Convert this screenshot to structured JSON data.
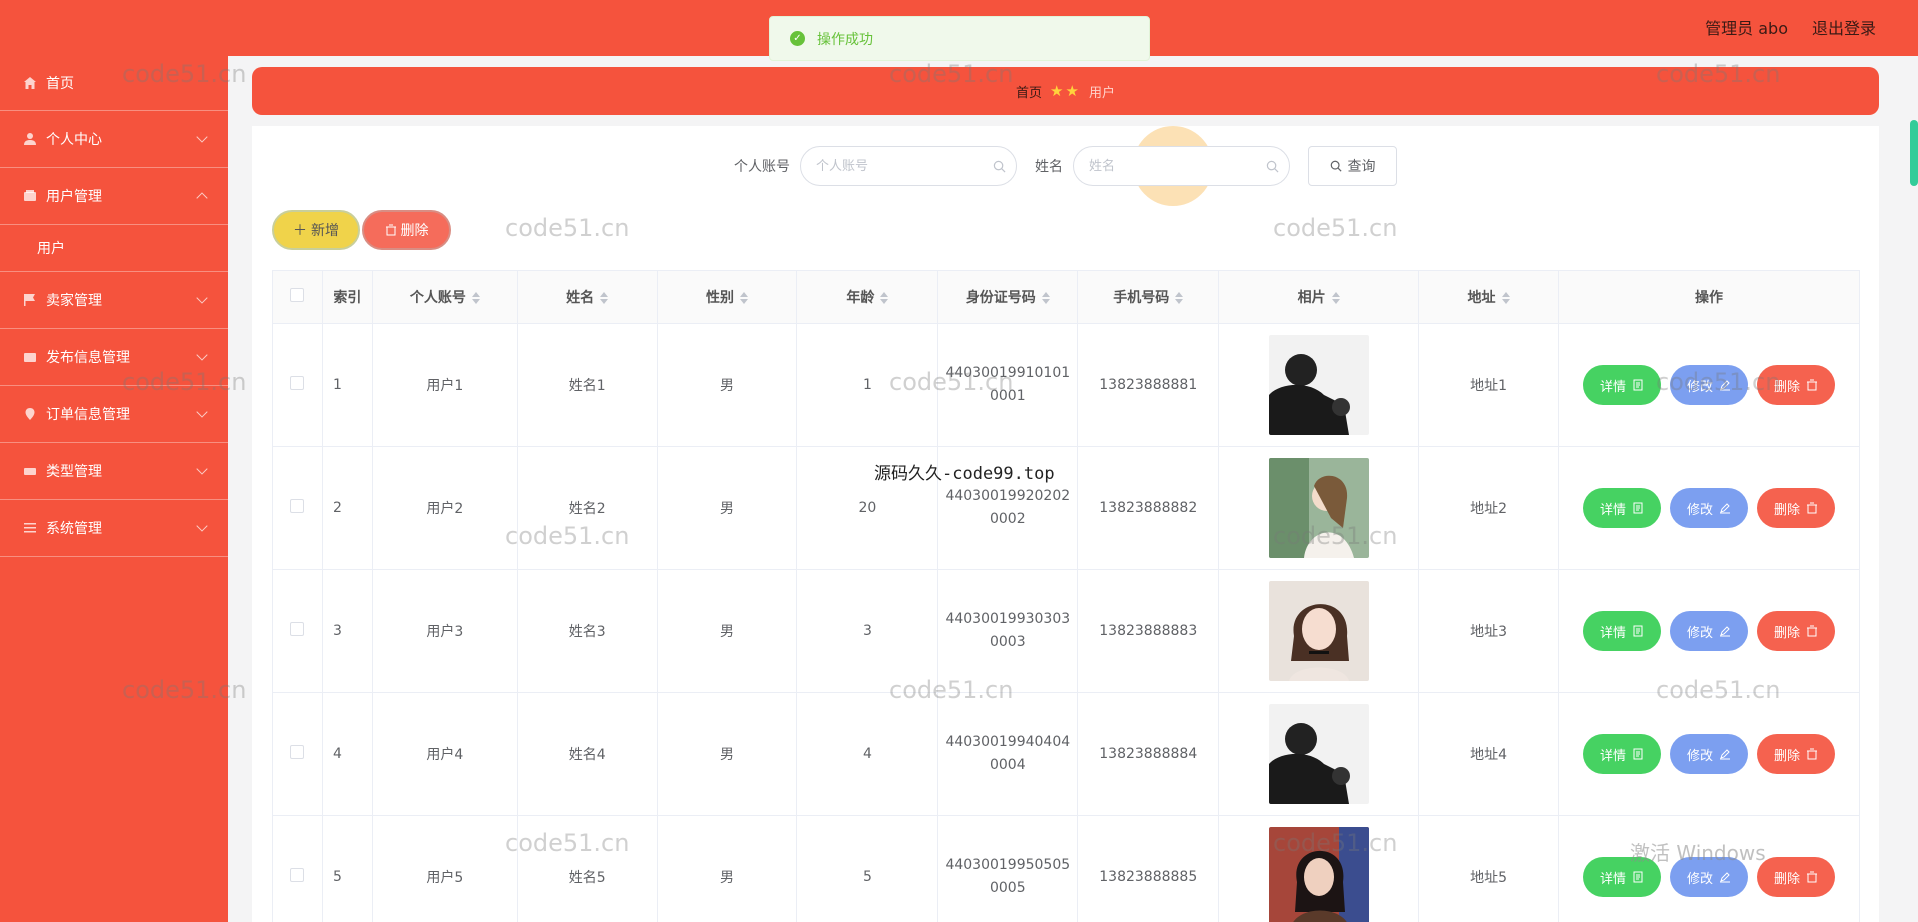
{
  "topbar": {
    "admin_label": "管理员 abo",
    "logout_label": "退出登录"
  },
  "toast": {
    "message": "操作成功"
  },
  "sidebar": {
    "items": [
      {
        "label": "首页",
        "icon": "home-icon"
      },
      {
        "label": "个人中心",
        "icon": "user-icon"
      },
      {
        "label": "用户管理",
        "icon": "folder-icon",
        "sub": "用户"
      },
      {
        "label": "卖家管理",
        "icon": "flag-icon"
      },
      {
        "label": "发布信息管理",
        "icon": "card-icon"
      },
      {
        "label": "订单信息管理",
        "icon": "location-icon"
      },
      {
        "label": "类型管理",
        "icon": "ticket-icon"
      },
      {
        "label": "系统管理",
        "icon": "settings-icon"
      }
    ]
  },
  "breadcrumb": {
    "home": "首页",
    "current": "用户"
  },
  "search": {
    "account_label": "个人账号",
    "account_placeholder": "个人账号",
    "name_label": "姓名",
    "name_placeholder": "姓名",
    "query_label": "查询"
  },
  "actions": {
    "add_label": "新增",
    "delete_label": "删除"
  },
  "table": {
    "headers": [
      "索引",
      "个人账号",
      "姓名",
      "性别",
      "年龄",
      "身份证号码",
      "手机号码",
      "相片",
      "地址",
      "操作"
    ],
    "rows": [
      {
        "index": "1",
        "account": "用户1",
        "name": "姓名1",
        "gender": "男",
        "age": "1",
        "id_a": "44030019910101",
        "id_b": "0001",
        "phone": "13823888881",
        "address": "地址1"
      },
      {
        "index": "2",
        "account": "用户2",
        "name": "姓名2",
        "gender": "男",
        "age": "20",
        "id_a": "44030019920202",
        "id_b": "0002",
        "phone": "13823888882",
        "address": "地址2"
      },
      {
        "index": "3",
        "account": "用户3",
        "name": "姓名3",
        "gender": "男",
        "age": "3",
        "id_a": "44030019930303",
        "id_b": "0003",
        "phone": "13823888883",
        "address": "地址3"
      },
      {
        "index": "4",
        "account": "用户4",
        "name": "姓名4",
        "gender": "男",
        "age": "4",
        "id_a": "44030019940404",
        "id_b": "0004",
        "phone": "13823888884",
        "address": "地址4"
      },
      {
        "index": "5",
        "account": "用户5",
        "name": "姓名5",
        "gender": "男",
        "age": "5",
        "id_a": "44030019950505",
        "id_b": "0005",
        "phone": "13823888885",
        "address": "地址5"
      }
    ],
    "row_actions": {
      "detail": "详情",
      "edit": "修改",
      "delete": "删除"
    }
  },
  "watermarks": {
    "site": "code51.cn",
    "code99": "源码久久-code99.top",
    "windows": "激活 Windows"
  },
  "colors": {
    "primary": "#f5533d",
    "green": "#46d262",
    "blue": "#7c9ff0",
    "red": "#f5624f",
    "yellow": "#f0d34a"
  }
}
